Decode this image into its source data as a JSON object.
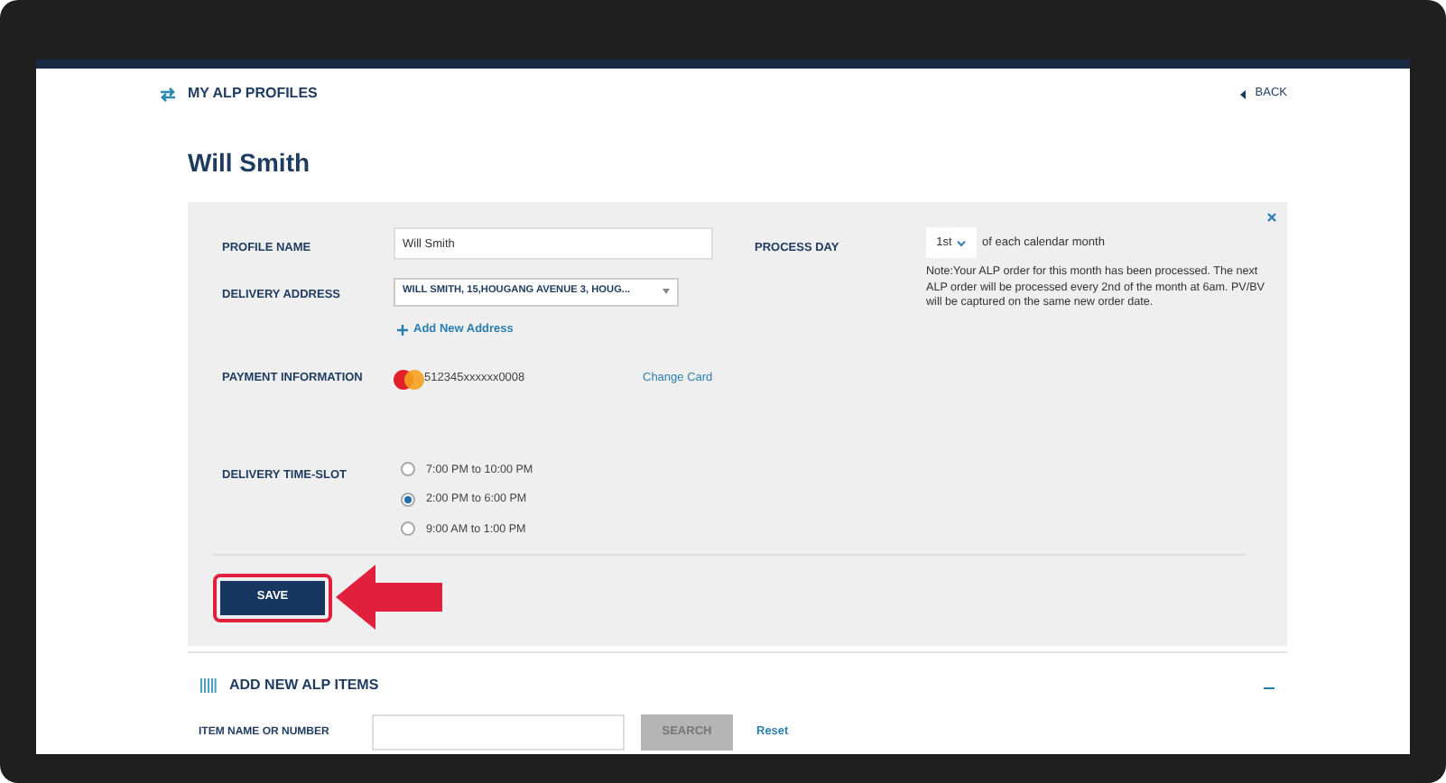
{
  "header": {
    "title": "MY ALP PROFILES",
    "back": "BACK"
  },
  "profile_title": "Will Smith",
  "form": {
    "profile_name": {
      "label": "PROFILE NAME",
      "value": "Will Smith"
    },
    "delivery_address": {
      "label": "DELIVERY ADDRESS",
      "value": "WILL SMITH, 15,HOUGANG AVENUE 3, HOUG...",
      "add_link": "Add New Address"
    },
    "payment": {
      "label": "PAYMENT INFORMATION",
      "card_number": "512345xxxxxx0008",
      "change_link": "Change Card"
    },
    "process_day": {
      "label": "PROCESS DAY",
      "value": "1st",
      "suffix": "of each calendar month",
      "note": "Note:Your ALP order for this month has been processed. The next ALP order will be processed every 2nd of the month at 6am. PV/BV will be captured on the same new order date."
    },
    "time_slot": {
      "label": "DELIVERY TIME-SLOT",
      "options": [
        {
          "label": "7:00 PM to 10:00 PM",
          "selected": false
        },
        {
          "label": "2:00 PM to 6:00 PM",
          "selected": true
        },
        {
          "label": "9:00 AM to 1:00 PM",
          "selected": false
        }
      ]
    },
    "save": "SAVE"
  },
  "add_items": {
    "title": "ADD NEW ALP ITEMS",
    "search_label": "ITEM NAME OR NUMBER",
    "search_button": "SEARCH",
    "reset": "Reset"
  }
}
